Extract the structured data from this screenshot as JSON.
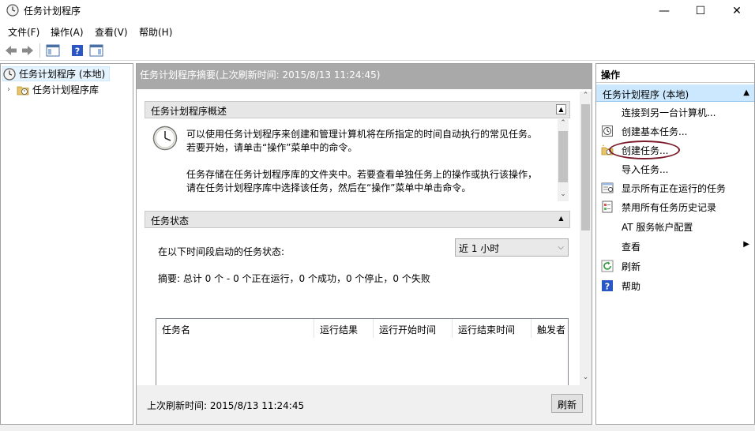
{
  "window": {
    "title": "任务计划程序",
    "icon": "clock-icon",
    "controls": {
      "minimize": "—",
      "maximize": "☐",
      "close": "✕"
    }
  },
  "menu": [
    "文件(F)",
    "操作(A)",
    "查看(V)",
    "帮助(H)"
  ],
  "toolbar": {
    "buttons": [
      "back-arrow-icon",
      "forward-arrow-icon",
      "show-hide-console-tree-icon",
      "help-icon",
      "show-hide-action-pane-icon"
    ]
  },
  "tree": {
    "items": [
      {
        "label": "任务计划程序 (本地)",
        "icon": "clock-icon",
        "selected": true
      },
      {
        "label": "任务计划程序库",
        "icon": "folder-clock-icon",
        "selected": false
      }
    ]
  },
  "center": {
    "header": "任务计划程序摘要(上次刷新时间: 2015/8/13 11:24:45)",
    "overview": {
      "title": "任务计划程序概述",
      "line1": "可以使用任务计划程序来创建和管理计算机将在所指定的时间自动执行的常见任务。",
      "line2": "若要开始，请单击“操作”菜单中的命令。",
      "line3": "任务存储在任务计划程序库的文件夹中。若要查看单独任务上的操作或执行该操作，",
      "line4": "请在任务计划程序库中选择该任务，然后在“操作”菜单中单击命令。"
    },
    "status": {
      "title": "任务状态",
      "period_label": "在以下时间段启动的任务状态:",
      "period_value": "近 1 小时",
      "summary": "摘要: 总计 0 个 - 0 个正在运行，0 个成功，0 个停止，0 个失败",
      "columns": [
        "任务名",
        "运行结果",
        "运行开始时间",
        "运行结束时间",
        "触发者"
      ]
    },
    "footer": {
      "last_refresh": "上次刷新时间: 2015/8/13 11:24:45",
      "refresh_button": "刷新"
    }
  },
  "actions": {
    "title": "操作",
    "group": "任务计划程序 (本地)",
    "items": [
      {
        "label": "连接到另一台计算机...",
        "icon": ""
      },
      {
        "label": "创建基本任务...",
        "icon": "basic-task-icon"
      },
      {
        "label": "创建任务...",
        "icon": "create-task-icon"
      },
      {
        "label": "导入任务...",
        "icon": ""
      },
      {
        "label": "显示所有正在运行的任务",
        "icon": "running-tasks-icon"
      },
      {
        "label": "禁用所有任务历史记录",
        "icon": "history-icon"
      },
      {
        "label": "AT 服务帐户配置",
        "icon": ""
      },
      {
        "label": "查看",
        "icon": "",
        "submenu": true
      },
      {
        "label": "刷新",
        "icon": "refresh-icon"
      },
      {
        "label": "帮助",
        "icon": "help-icon"
      }
    ]
  },
  "colors": {
    "header_bg": "#a9a9a9",
    "selection_bg": "#cce8ff",
    "annotation_circle": "#7a1a2a"
  }
}
